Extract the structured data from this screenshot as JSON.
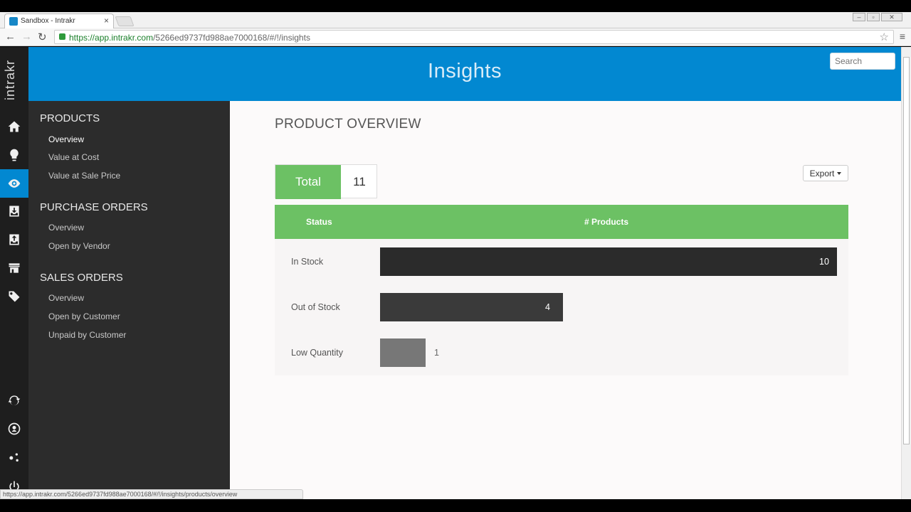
{
  "browser": {
    "tab_title": "Sandbox - Intrakr",
    "tab_close": "×",
    "url_scheme": "https://",
    "url_domain": "app.intrakr.com",
    "url_path": "/5266ed9737fd988ae7000168/#/!/insights",
    "status_url": "https://app.intrakr.com/5266ed9737fd988ae7000168/#/!/insights/products/overview"
  },
  "app": {
    "logo": "intrakr",
    "page_title": "Insights",
    "search_placeholder": "Search",
    "accent": "#0288d1",
    "green": "#6cc164"
  },
  "sidebar": {
    "sections": [
      {
        "title": "PRODUCTS",
        "items": [
          "Overview",
          "Value at Cost",
          "Value at Sale Price"
        ]
      },
      {
        "title": "PURCHASE ORDERS",
        "items": [
          "Overview",
          "Open by Vendor"
        ]
      },
      {
        "title": "SALES ORDERS",
        "items": [
          "Overview",
          "Open by Customer",
          "Unpaid by Customer"
        ]
      }
    ],
    "icons": [
      "home-icon",
      "lightbulb-icon",
      "eye-icon",
      "inbox-download-icon",
      "inbox-upload-icon",
      "store-icon",
      "tags-icon",
      "sync-icon",
      "user-circle-icon",
      "settings-icon",
      "power-icon"
    ]
  },
  "main": {
    "heading": "PRODUCT OVERVIEW",
    "total_label": "Total",
    "total_value": "11",
    "export_label": "Export",
    "table": {
      "headers": [
        "Status",
        "# Products"
      ]
    }
  },
  "chart_data": {
    "type": "bar",
    "categories": [
      "In Stock",
      "Out of Stock",
      "Low Quantity"
    ],
    "values": [
      10,
      4,
      1
    ],
    "xlabel": "",
    "ylabel": "",
    "xlim": [
      0,
      10
    ],
    "colors": [
      "#2b2b2b",
      "#3a3a3a",
      "#777777"
    ]
  }
}
